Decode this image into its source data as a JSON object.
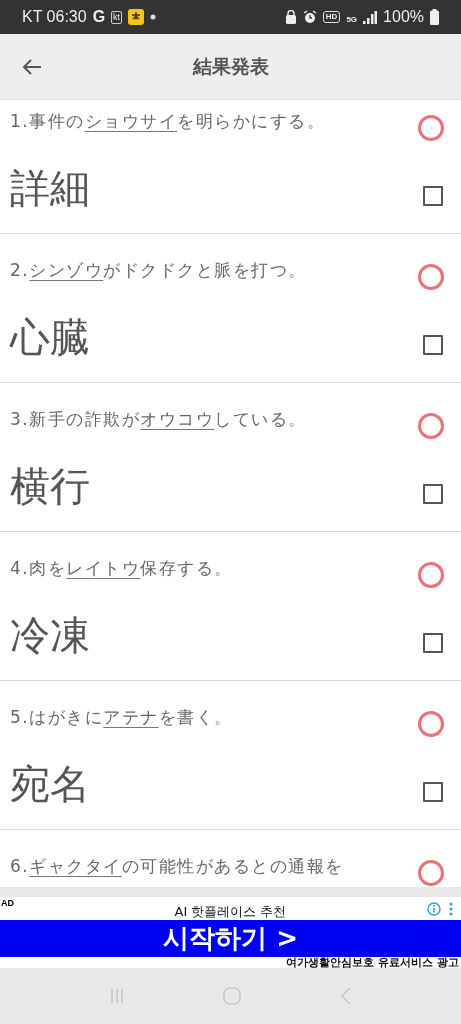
{
  "status_bar": {
    "carrier_time": "KT 06:30",
    "g_label": "G",
    "carrier_badge": "kt",
    "hd_badge": "HD",
    "network_badge": "5G",
    "battery": "100%"
  },
  "header": {
    "title": "結果発表"
  },
  "questions": [
    {
      "number": "1.",
      "before": "事件の",
      "underlined": "ショウサイ",
      "after": "を明らかにする。",
      "answer": "詳細",
      "correct": true,
      "checked": false
    },
    {
      "number": "2.",
      "underlined": "シンゾウ",
      "after": "がドクドクと脈を打つ。",
      "answer": "心臓",
      "correct": true,
      "checked": false
    },
    {
      "number": "3.",
      "before": "新手の詐欺が",
      "underlined": "オウコウ",
      "after": "している。",
      "answer": "横行",
      "correct": true,
      "checked": false
    },
    {
      "number": "4.",
      "before": "肉を",
      "underlined": "レイトウ",
      "after": "保存する。",
      "answer": "冷凍",
      "correct": true,
      "checked": false
    },
    {
      "number": "5.",
      "before": "はがきに",
      "underlined": "アテナ",
      "after": "を書く。",
      "answer": "宛名",
      "correct": true,
      "checked": false
    },
    {
      "number": "6.",
      "underlined": "ギャクタイ",
      "after": "の可能性があるとの通報を",
      "correct": true
    }
  ],
  "ad": {
    "badge": "AD",
    "headline": "AI 핫플레이스 추천",
    "cta": "시작하기 >",
    "footer": "여가생활안심보호 유료서비스 광고"
  }
}
